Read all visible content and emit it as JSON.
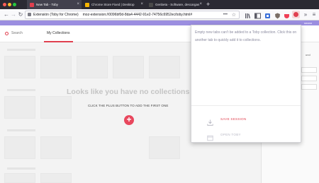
{
  "tabs": [
    {
      "title": "New Tab - Toby",
      "favicon_color": "#e0404f",
      "active": true
    },
    {
      "title": "Chrome Store Fixed | Desktop",
      "favicon_color": "#f5b400",
      "active": false
    },
    {
      "title": "Genbeta - Software, descargas",
      "favicon_color": "#4a4a4a",
      "active": false
    }
  ],
  "toolbar": {
    "back_icon": "back-arrow-icon",
    "forward_icon": "forward-arrow-icon",
    "reload_icon": "reload-icon",
    "extension_label": "Extensión (Toby for Chrome)",
    "url": "moz-extension://0096bf0d-8da4-4442-91e2-74756c6952ec/toby.html#",
    "page_actions_glyph": "•••"
  },
  "page": {
    "purple_bar_text": "aaaaa",
    "search_label": "Search",
    "collections_tab": "My Collections",
    "empty_title": "Looks like you have no collections yet.",
    "empty_subtitle": "CLICK THE PLUS BUTTON TO ADD THE FIRST ONE",
    "plus_glyph": "+",
    "right_label": "und",
    "accent_color": "#e0404f"
  },
  "popup": {
    "message": "Empty new tabs can't be added to a Toby collection. Click this on another tab to quickly add it to collections.",
    "save_label": "SAVE SESSION",
    "open_label": "OPEN TOBY"
  }
}
